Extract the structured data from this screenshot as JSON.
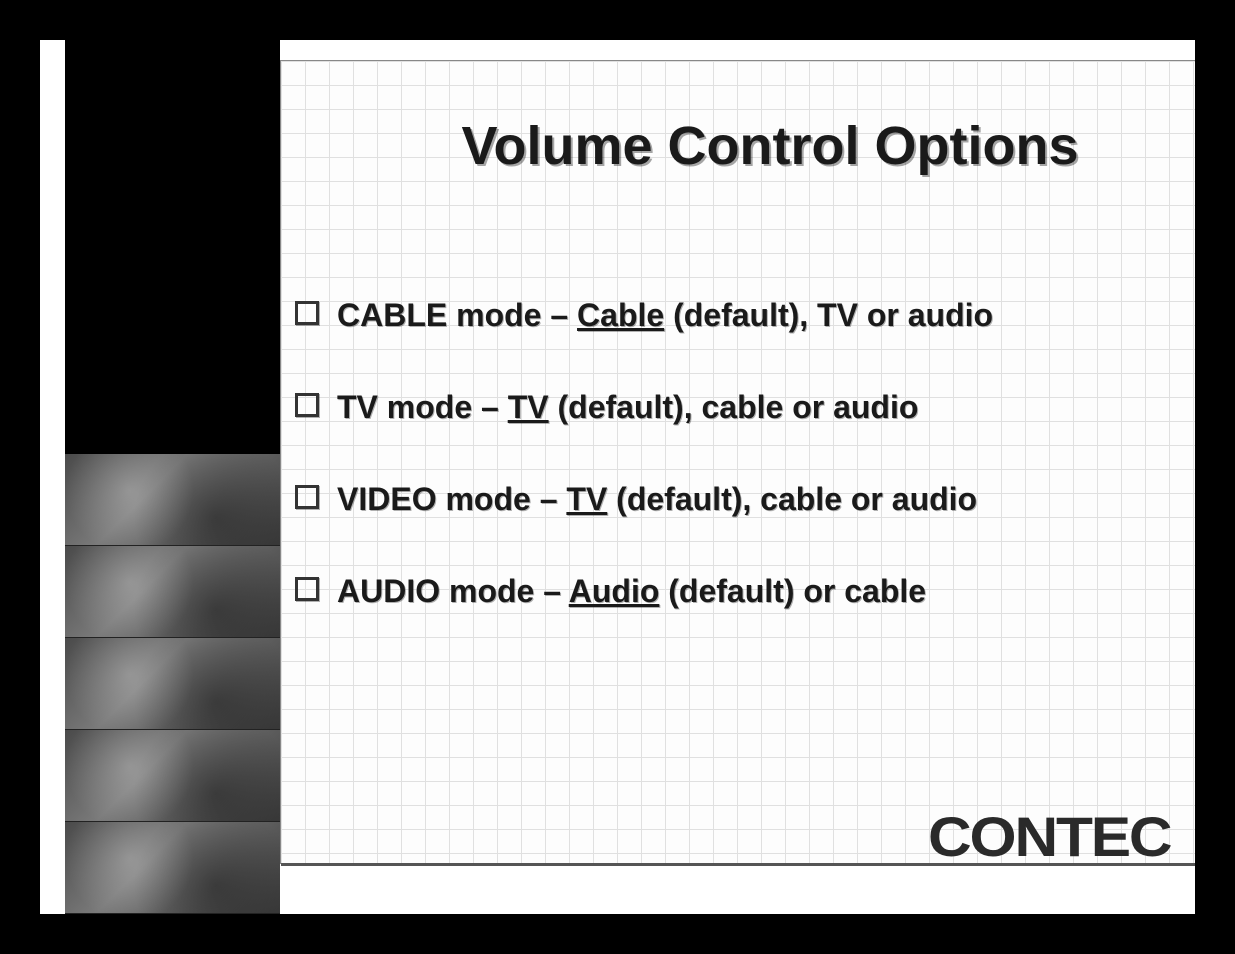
{
  "title": "Volume Control Options",
  "bullets": [
    {
      "prefix": "CABLE mode – ",
      "underline": "Cable",
      "suffix": " (default), TV or audio"
    },
    {
      "prefix": "TV mode – ",
      "underline": "TV",
      "suffix": " (default), cable or audio"
    },
    {
      "prefix": "VIDEO mode – ",
      "underline": "TV",
      "suffix": " (default), cable or audio"
    },
    {
      "prefix": "AUDIO mode – ",
      "underline": "Audio",
      "suffix": " (default) or cable"
    }
  ],
  "logo": "CONTEC"
}
